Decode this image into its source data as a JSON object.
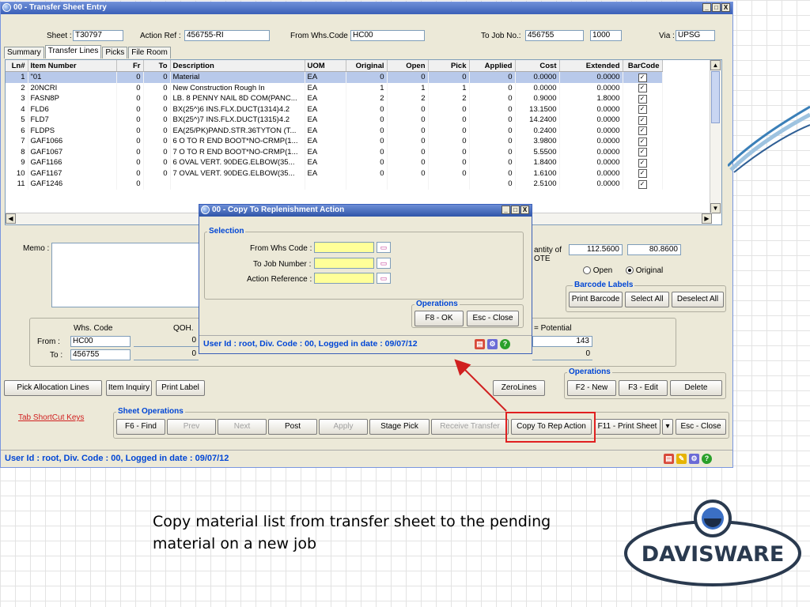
{
  "window": {
    "title": "00 - Transfer Sheet Entry",
    "controls": [
      "_",
      "□",
      "X"
    ]
  },
  "header": {
    "sheet_label": "Sheet :",
    "sheet_value": "T30797",
    "action_ref_label": "Action Ref :",
    "action_ref_value": "456755-RI",
    "from_whs_label": "From Whs.Code :",
    "from_whs_value": "HC00",
    "to_job_label": "To Job No.:",
    "to_job_value": "456755",
    "to_job_extra": "1000",
    "via_label": "Via :",
    "via_value": "UPSG"
  },
  "tabs": [
    "Summary",
    "Transfer Lines",
    "Picks",
    "File Room"
  ],
  "grid": {
    "columns": [
      "Ln#",
      "Item Number",
      "Fr",
      "To",
      "Description",
      "UOM",
      "Original",
      "Open",
      "Pick",
      "Applied",
      "Cost",
      "Extended",
      "BarCode"
    ],
    "rows": [
      [
        "1",
        "\"01",
        "0",
        "0",
        "Material",
        "EA",
        "0",
        "0",
        "0",
        "0",
        "0.0000",
        "0.0000"
      ],
      [
        "2",
        "20NCRI",
        "0",
        "0",
        "New Construction Rough In",
        "EA",
        "1",
        "1",
        "1",
        "0",
        "0.0000",
        "0.0000"
      ],
      [
        "3",
        "FASN8P",
        "0",
        "0",
        "LB. 8  PENNY NAIL 8D COM(PANC...",
        "EA",
        "2",
        "2",
        "2",
        "0",
        "0.9000",
        "1.8000"
      ],
      [
        "4",
        "FLD6",
        "0",
        "0",
        "BX(25^)6 INS.FLX.DUCT(1314)4.2",
        "EA",
        "0",
        "0",
        "0",
        "0",
        "13.1500",
        "0.0000"
      ],
      [
        "5",
        "FLD7",
        "0",
        "0",
        "BX(25^)7 INS.FLX.DUCT(1315)4.2",
        "EA",
        "0",
        "0",
        "0",
        "0",
        "14.2400",
        "0.0000"
      ],
      [
        "6",
        "FLDPS",
        "0",
        "0",
        "EA(25/PK)PAND.STR.36TYTON (T...",
        "EA",
        "0",
        "0",
        "0",
        "0",
        "0.2400",
        "0.0000"
      ],
      [
        "7",
        "GAF1066",
        "0",
        "0",
        "6 O TO R END BOOT*NO-CRMP(1...",
        "EA",
        "0",
        "0",
        "0",
        "0",
        "3.9800",
        "0.0000"
      ],
      [
        "8",
        "GAF1067",
        "0",
        "0",
        "7 O TO R END BOOT*NO-CRMP(1...",
        "EA",
        "0",
        "0",
        "0",
        "0",
        "5.5500",
        "0.0000"
      ],
      [
        "9",
        "GAF1166",
        "0",
        "0",
        "6 OVAL VERT. 90DEG.ELBOW(35...",
        "EA",
        "0",
        "0",
        "0",
        "0",
        "1.8400",
        "0.0000"
      ],
      [
        "10",
        "GAF1167",
        "0",
        "0",
        "7 OVAL VERT. 90DEG.ELBOW(35...",
        "EA",
        "0",
        "0",
        "0",
        "0",
        "1.6100",
        "0.0000"
      ],
      [
        "11",
        "GAF1246",
        "0",
        "",
        "",
        "",
        "",
        "",
        "",
        "0",
        "2.5100",
        "0.0000"
      ]
    ]
  },
  "memo_label": "Memo :",
  "totals": {
    "qty_label": "antity of",
    "qty_label2": "OTE",
    "cost_total": "112.5600",
    "ext_total": "80.8600",
    "open_label": "Open",
    "original_label": "Original"
  },
  "barcode": {
    "title": "Barcode Labels",
    "print": "Print Barcode",
    "select_all": "Select All",
    "deselect_all": "Deselect All"
  },
  "whs": {
    "code_label": "Whs. Code",
    "qoh_label": "QOH.",
    "from_label": "From :",
    "from_value": "HC00",
    "from_qoh": "0",
    "to_label": "To :",
    "to_value": "456755",
    "to_qoh": "0",
    "potential_label": "= Potential",
    "potential_from": "143",
    "potential_to": "0"
  },
  "buttons": {
    "pick_alloc": "Pick Allocation Lines",
    "item_inquiry": "Item Inquiry",
    "print_label": "Print Label",
    "zero_lines": "ZeroLines"
  },
  "operations": {
    "title": "Operations",
    "new": "F2 - New",
    "edit": "F3 - Edit",
    "delete": "Delete"
  },
  "sheet_ops": {
    "shortcut_link": "Tab ShortCut Keys",
    "title": "Sheet Operations",
    "find": "F6 - Find",
    "prev": "Prev",
    "next": "Next",
    "post": "Post",
    "apply": "Apply",
    "stage_pick": "Stage Pick",
    "receive_transfer": "Receive Transfer",
    "copy_to_rep": "Copy To Rep Action",
    "print_sheet": "F11 - Print Sheet",
    "close": "Esc - Close"
  },
  "status": "User Id : root, Div. Code : 00, Logged in date : 09/07/12",
  "dialog": {
    "title": "00 - Copy To Replenishment Action",
    "selection_title": "Selection",
    "from_whs_label": "From Whs Code :",
    "to_job_label": "To Job Number :",
    "action_ref_label": "Action Reference :",
    "ops_title": "Operations",
    "ok": "F8 - OK",
    "close": "Esc - Close",
    "status": "User Id : root, Div. Code : 00, Logged in date : 09/07/12"
  },
  "caption": "Copy material list from transfer sheet to the pending material on a new job",
  "logo_text": "DAVISWARE",
  "colors": {
    "accent": "#0046d5",
    "highlight": "#e02020",
    "title_bar": "#3a5fb8",
    "required_field": "#ffff99"
  }
}
